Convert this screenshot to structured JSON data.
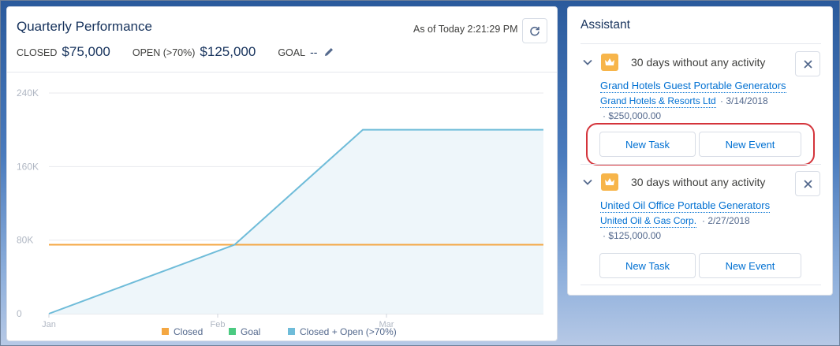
{
  "quarterly_performance": {
    "title": "Quarterly Performance",
    "as_of": "As of Today 2:21:29 PM",
    "closed_label": "CLOSED",
    "closed_value": "$75,000",
    "open_label": "OPEN (>70%)",
    "open_value": "$125,000",
    "goal_label": "GOAL",
    "goal_value": "--",
    "refresh_icon": "refresh-icon",
    "edit_icon": "pencil-icon"
  },
  "chart_data": {
    "type": "line",
    "y_tick_labels": [
      "0",
      "80K",
      "160K",
      "240K"
    ],
    "y_ticks": [
      0,
      80000,
      160000,
      240000
    ],
    "ylim": [
      0,
      240000
    ],
    "x_tick_labels": [
      "Jan",
      "Feb",
      "Mar"
    ],
    "x_ticks": [
      0,
      1,
      2
    ],
    "xlim": [
      0,
      2.93
    ],
    "legend_position": "bottom",
    "series": [
      {
        "name": "Closed",
        "color": "#f4a742",
        "points": [
          [
            0,
            75000
          ],
          [
            2.93,
            75000
          ]
        ]
      },
      {
        "name": "Goal",
        "color": "#4bca81",
        "points": []
      },
      {
        "name": "Closed + Open (>70%)",
        "color": "#6fbcd9",
        "fill": "#eef6fa",
        "points": [
          [
            0,
            0
          ],
          [
            1.1,
            75000
          ],
          [
            1.86,
            200000
          ],
          [
            2.93,
            200000
          ]
        ]
      }
    ]
  },
  "assistant": {
    "title": "Assistant",
    "crown_icon": "crown-icon",
    "items": [
      {
        "message": "30 days without any activity",
        "opportunity": "Grand Hotels Guest Portable Generators",
        "account": "Grand Hotels & Resorts Ltd",
        "date": "· 3/14/2018",
        "amount": "· $250,000.00",
        "new_task": "New Task",
        "new_event": "New Event"
      },
      {
        "message": "30 days without any activity",
        "opportunity": "United Oil Office Portable Generators",
        "account": "United Oil & Gas Corp.",
        "date": "· 2/27/2018",
        "amount": "· $125,000.00",
        "new_task": "New Task",
        "new_event": "New Event"
      }
    ]
  }
}
